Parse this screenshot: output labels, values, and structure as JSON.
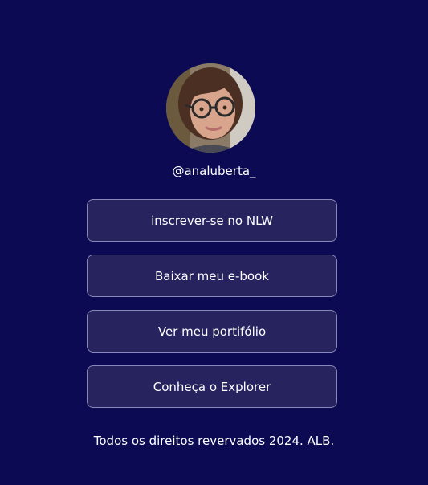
{
  "profile": {
    "username": "@analuberta_"
  },
  "links": [
    {
      "label": "inscrever-se no NLW"
    },
    {
      "label": "Baixar meu e-book"
    },
    {
      "label": "Ver meu portifólio"
    },
    {
      "label": "Conheça o Explorer"
    }
  ],
  "footer": {
    "text": "Todos os direitos revervados 2024. ALB."
  },
  "colors": {
    "background": "#0b0a52",
    "button_bg": "#26235f",
    "button_border": "#8a88b8",
    "text": "#ffffff"
  }
}
